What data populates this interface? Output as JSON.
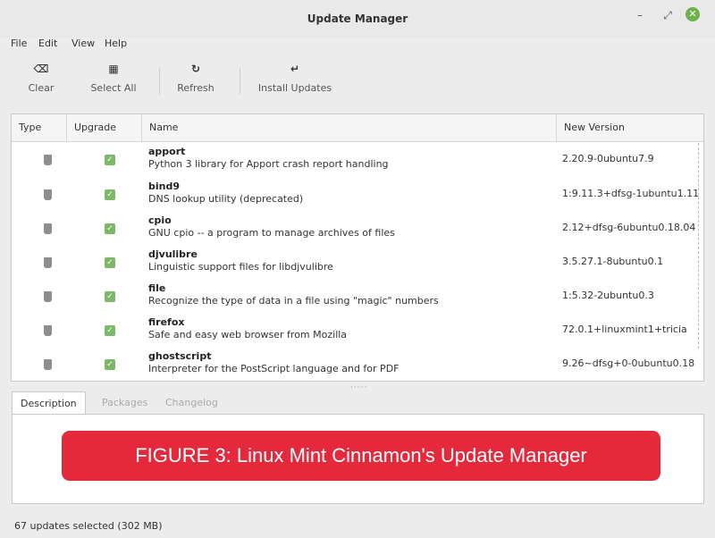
{
  "window": {
    "title": "Update Manager",
    "min": "–",
    "max": "⤢",
    "close": "✕"
  },
  "menu": [
    "File",
    "Edit",
    "View",
    "Help"
  ],
  "toolbar": {
    "clear": {
      "label": "Clear",
      "icon": "⌫"
    },
    "select_all": {
      "label": "Select All",
      "icon": "▦"
    },
    "refresh": {
      "label": "Refresh",
      "icon": "↻"
    },
    "install": {
      "label": "Install Updates",
      "icon": "↵"
    }
  },
  "columns": {
    "type": "Type",
    "upgrade": "Upgrade",
    "name": "Name",
    "version": "New Version"
  },
  "packages": [
    {
      "name": "apport",
      "description": "Python 3 library for Apport crash report handling",
      "version": "2.20.9-0ubuntu7.9",
      "checked": true
    },
    {
      "name": "bind9",
      "description": "DNS lookup utility (deprecated)",
      "version": "1:9.11.3+dfsg-1ubuntu1.11",
      "checked": true
    },
    {
      "name": "cpio",
      "description": "GNU cpio -- a program to manage archives of files",
      "version": "2.12+dfsg-6ubuntu0.18.04",
      "checked": true
    },
    {
      "name": "djvulibre",
      "description": "Linguistic support files for libdjvulibre",
      "version": "3.5.27.1-8ubuntu0.1",
      "checked": true
    },
    {
      "name": "file",
      "description": "Recognize the type of data in a file using \"magic\" numbers",
      "version": "1:5.32-2ubuntu0.3",
      "checked": true
    },
    {
      "name": "firefox",
      "description": "Safe and easy web browser from Mozilla",
      "version": "72.0.1+linuxmint1+tricia",
      "checked": true
    },
    {
      "name": "ghostscript",
      "description": "Interpreter for the PostScript language and for PDF",
      "version": "9.26~dfsg+0-0ubuntu0.18",
      "checked": true
    }
  ],
  "tabs": [
    "Description",
    "Packages",
    "Changelog"
  ],
  "caption": "FIGURE 3: Linux Mint Cinnamon's Update Manager",
  "status": "67 updates selected (302 MB)",
  "colors": {
    "accent_green": "#7cb867",
    "caption_red": "#e3293b"
  }
}
